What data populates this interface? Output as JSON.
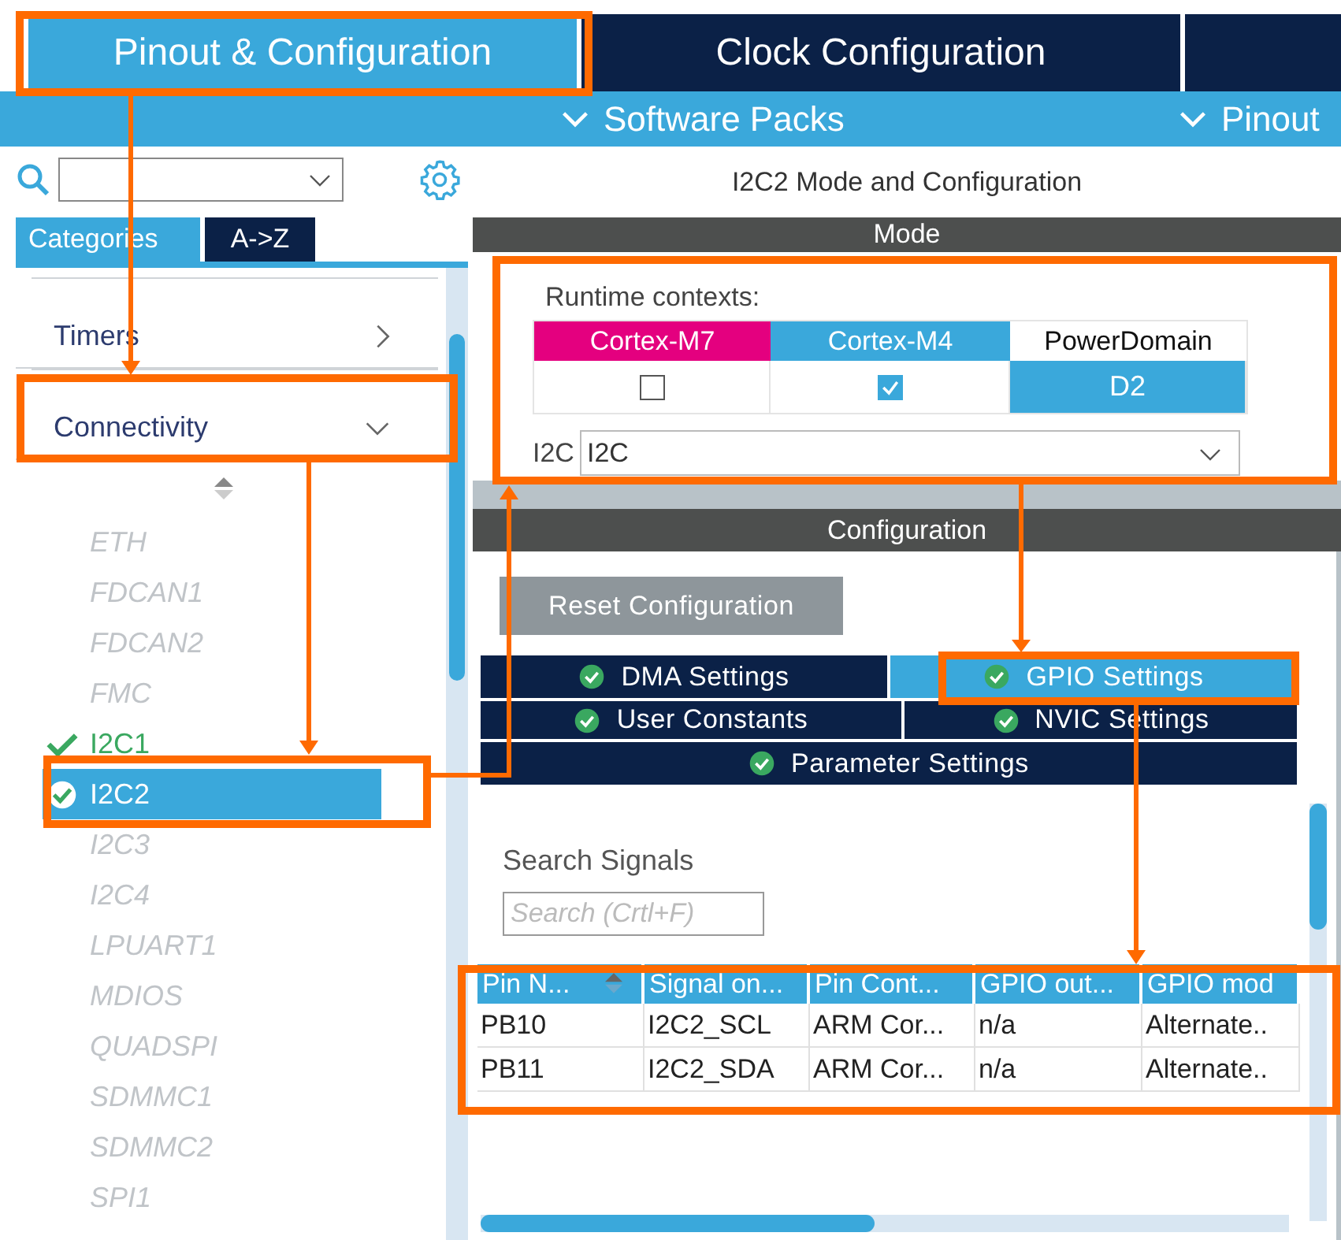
{
  "top_tabs": [
    {
      "label": "Pinout & Configuration",
      "selected": true
    },
    {
      "label": "Clock Configuration",
      "selected": false
    },
    {
      "selected": false
    }
  ],
  "menu_bar": [
    {
      "label": "Software Packs"
    },
    {
      "label": "Pinout"
    }
  ],
  "left_panel": {
    "view_tabs": [
      {
        "label": "Categories",
        "selected": true
      },
      {
        "label": "A->Z",
        "selected": false
      }
    ],
    "categories": [
      {
        "label": "Timers",
        "expanded": false
      },
      {
        "label": "Connectivity",
        "expanded": true,
        "children": [
          {
            "label": "ETH",
            "configured": false,
            "selected": false
          },
          {
            "label": "FDCAN1",
            "configured": false,
            "selected": false
          },
          {
            "label": "FDCAN2",
            "configured": false,
            "selected": false
          },
          {
            "label": "FMC",
            "configured": false,
            "selected": false
          },
          {
            "label": "I2C1",
            "configured": true,
            "selected": false
          },
          {
            "label": "I2C2",
            "configured": true,
            "selected": true
          },
          {
            "label": "I2C3",
            "configured": false,
            "selected": false
          },
          {
            "label": "I2C4",
            "configured": false,
            "selected": false
          },
          {
            "label": "LPUART1",
            "configured": false,
            "selected": false
          },
          {
            "label": "MDIOS",
            "configured": false,
            "selected": false
          },
          {
            "label": "QUADSPI",
            "configured": false,
            "selected": false
          },
          {
            "label": "SDMMC1",
            "configured": false,
            "selected": false
          },
          {
            "label": "SDMMC2",
            "configured": false,
            "selected": false
          },
          {
            "label": "SPI1",
            "configured": false,
            "selected": false
          }
        ]
      }
    ]
  },
  "right_panel": {
    "title": "I2C2 Mode and Configuration",
    "mode_header": "Mode",
    "runtime_label": "Runtime contexts:",
    "contexts": [
      {
        "label": "Cortex-M7",
        "kind": "checkbox",
        "color": "#e4007f",
        "checked": false
      },
      {
        "label": "Cortex-M4",
        "kind": "checkbox",
        "color": "#3aa8db",
        "checked": true
      },
      {
        "label": "PowerDomain",
        "kind": "value",
        "value": "D2"
      }
    ],
    "mode_field": {
      "label": "I2C",
      "value": "I2C"
    },
    "config_header": "Configuration",
    "reset_button": {
      "label": "Reset Configuration",
      "disabled": true
    },
    "settings_tabs": [
      [
        {
          "label": "DMA Settings",
          "configured": true,
          "selected": false
        },
        {
          "label": "GPIO Settings",
          "configured": true,
          "selected": true
        }
      ],
      [
        {
          "label": "User Constants",
          "configured": true,
          "selected": false
        },
        {
          "label": "NVIC Settings",
          "configured": true,
          "selected": false
        }
      ],
      [
        {
          "label": "Parameter Settings",
          "configured": true,
          "selected": false
        }
      ]
    ],
    "search_label": "Search Signals",
    "search": {
      "placeholder": "Search (Crtl+F)"
    },
    "table": {
      "columns": [
        "Pin N...",
        "Signal on...",
        "Pin Cont...",
        "GPIO out...",
        "GPIO mod"
      ],
      "rows": [
        [
          "PB10",
          "I2C2_SCL",
          "ARM Cor...",
          "n/a",
          "Alternate.."
        ],
        [
          "PB11",
          "I2C2_SDA",
          "ARM Cor...",
          "n/a",
          "Alternate.."
        ]
      ]
    }
  }
}
